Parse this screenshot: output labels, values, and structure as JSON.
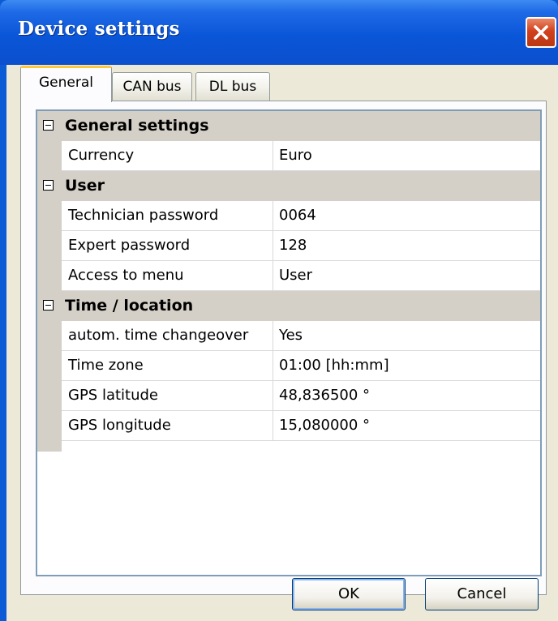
{
  "window": {
    "title": "Device settings",
    "close_icon": "close-icon"
  },
  "tabs": [
    {
      "label": "General",
      "active": true
    },
    {
      "label": "CAN bus",
      "active": false
    },
    {
      "label": "DL bus",
      "active": false
    }
  ],
  "sections": [
    {
      "title": "General settings",
      "rows": [
        {
          "name": "Currency",
          "value": "Euro"
        }
      ]
    },
    {
      "title": "User",
      "rows": [
        {
          "name": "Technician password",
          "value": "0064"
        },
        {
          "name": "Expert password",
          "value": "128"
        },
        {
          "name": "Access to menu",
          "value": "User"
        }
      ]
    },
    {
      "title": "Time / location",
      "rows": [
        {
          "name": "autom. time changeover",
          "value": "Yes"
        },
        {
          "name": "Time zone",
          "value": "01:00 [hh:mm]"
        },
        {
          "name": "GPS latitude",
          "value": "48,836500 °"
        },
        {
          "name": "GPS longitude",
          "value": "15,080000 °"
        }
      ]
    }
  ],
  "buttons": {
    "ok_label": "OK",
    "cancel_label": "Cancel"
  },
  "colors": {
    "titlebar": "#0a56d8",
    "dialog_bg": "#ece9d8",
    "category_bg": "#d4d0c8",
    "active_tab_accent": "#ffc83c"
  }
}
